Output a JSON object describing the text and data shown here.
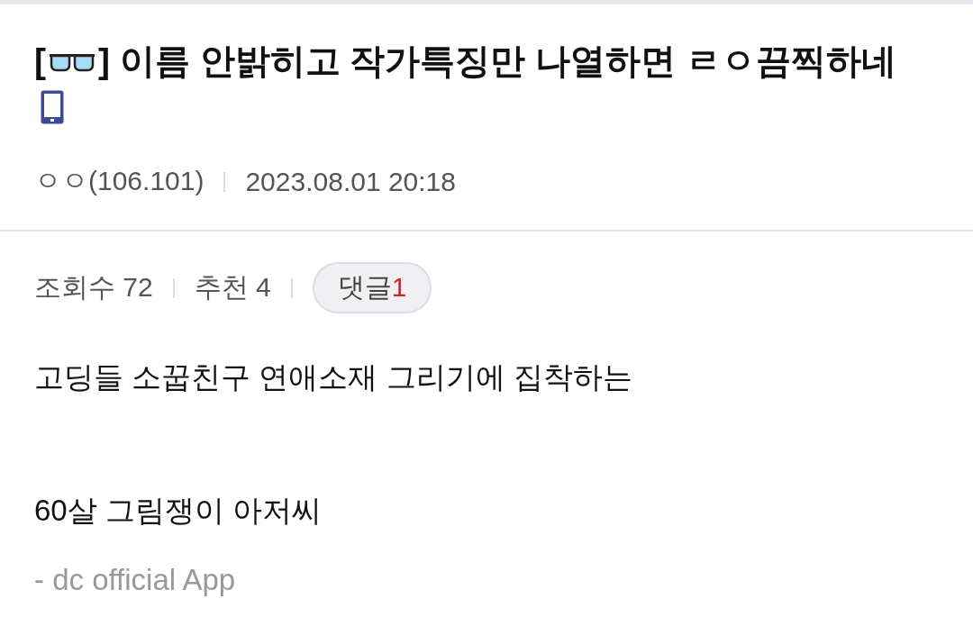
{
  "post": {
    "title_open": "[",
    "title_close": "] 이름 안밝히고 작가특징만 나열하면 ㄹㅇ끔찍하네",
    "author": "ㅇㅇ(106.101)",
    "date": "2023.08.01 20:18"
  },
  "stats": {
    "views_label": "조회수 72",
    "recommend_label": "추천 4",
    "comments_label": "댓글",
    "comments_count": "1"
  },
  "body": [
    "고딩들 소꿉친구 연애소재 그리기에 집착하는",
    "60살 그림쟁이 아저씨"
  ],
  "signature": "- dc official App"
}
